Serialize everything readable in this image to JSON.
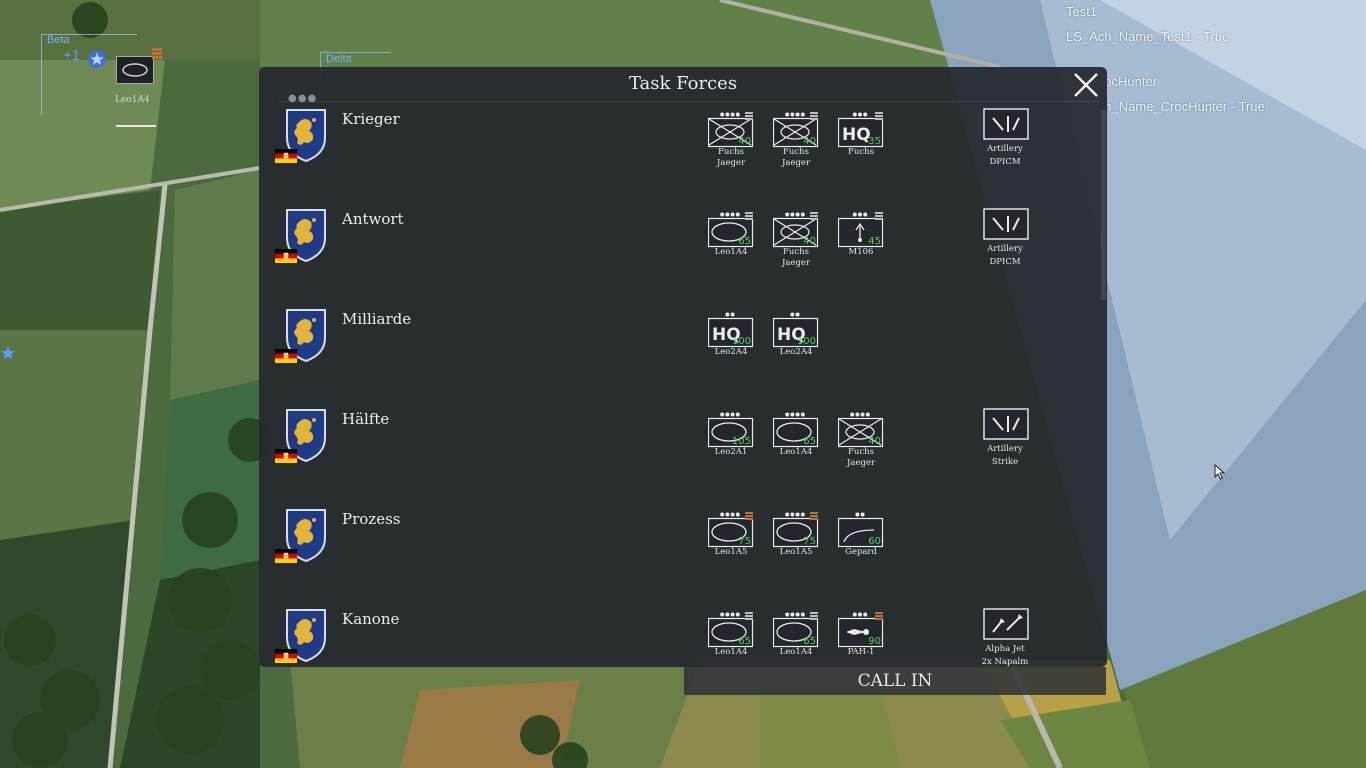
{
  "debug": {
    "lines": [
      "Test1",
      "LS_Ach_Name_Test1 - True",
      "TR_CrocHunter",
      "LS_Ach_Name_CrocHunter - True"
    ]
  },
  "map": {
    "markers": {
      "beta": "Beta",
      "delta": "Delta",
      "plus": "+1",
      "unit_label": "Leo1A4"
    }
  },
  "panel": {
    "title": "Task Forces",
    "call_in": "CALL IN",
    "task_forces": [
      {
        "name": "Krieger",
        "units": [
          {
            "label": "Fuchs\nJaeger",
            "type": "inf-x",
            "value": "40",
            "pips": 4,
            "rank": "silver"
          },
          {
            "label": "Fuchs\nJaeger",
            "type": "inf-x",
            "value": "40",
            "pips": 4,
            "rank": "silver"
          },
          {
            "label": "Fuchs",
            "type": "hq",
            "value": "35",
            "pips": 3,
            "rank": "silver"
          }
        ],
        "support": {
          "label": "Artillery\nDPICM",
          "type": "artillery"
        }
      },
      {
        "name": "Antwort",
        "units": [
          {
            "label": "Leo1A4",
            "type": "armor",
            "value": "65",
            "pips": 4,
            "rank": "silver"
          },
          {
            "label": "Fuchs\nJaeger",
            "type": "inf-x",
            "value": "40",
            "pips": 4,
            "rank": "silver"
          },
          {
            "label": "M106",
            "type": "mortar",
            "value": "45",
            "pips": 3,
            "rank": "silver"
          }
        ],
        "support": {
          "label": "Artillery\nDPICM",
          "type": "artillery"
        }
      },
      {
        "name": "Milliarde",
        "units": [
          {
            "label": "Leo2A4",
            "type": "hq",
            "value": "100",
            "pips": 2,
            "rank": ""
          },
          {
            "label": "Leo2A4",
            "type": "hq",
            "value": "100",
            "pips": 2,
            "rank": ""
          }
        ],
        "support": null
      },
      {
        "name": "Hälfte",
        "units": [
          {
            "label": "Leo2A1",
            "type": "armor",
            "value": "105",
            "pips": 4,
            "rank": ""
          },
          {
            "label": "Leo1A4",
            "type": "armor",
            "value": "65",
            "pips": 4,
            "rank": ""
          },
          {
            "label": "Fuchs\nJaeger",
            "type": "inf-x",
            "value": "40",
            "pips": 4,
            "rank": ""
          }
        ],
        "support": {
          "label": "Artillery\nStrike",
          "type": "artillery"
        }
      },
      {
        "name": "Prozess",
        "units": [
          {
            "label": "Leo1A5",
            "type": "armor",
            "value": "75",
            "pips": 4,
            "rank": "bronze"
          },
          {
            "label": "Leo1A5",
            "type": "armor",
            "value": "75",
            "pips": 4,
            "rank": "bronze"
          },
          {
            "label": "Gepard",
            "type": "aa",
            "value": "60",
            "pips": 2,
            "rank": ""
          }
        ],
        "support": null
      },
      {
        "name": "Kanone",
        "units": [
          {
            "label": "Leo1A4",
            "type": "armor",
            "value": "65",
            "pips": 4,
            "rank": "silver"
          },
          {
            "label": "Leo1A4",
            "type": "armor",
            "value": "65",
            "pips": 4,
            "rank": "silver"
          },
          {
            "label": "PAH-1",
            "type": "heli",
            "value": "90",
            "pips": 3,
            "rank": "bronze"
          }
        ],
        "support": {
          "label": "Alpha Jet\n2x Napalm",
          "type": "air"
        }
      }
    ]
  },
  "colors": {
    "value_green": "#4fd25a",
    "silver": "#b9bcc0",
    "bronze": "#c0703a",
    "panel": "#262930",
    "crest_blue": "#1f3b86",
    "crest_gold": "#e2b53a"
  }
}
